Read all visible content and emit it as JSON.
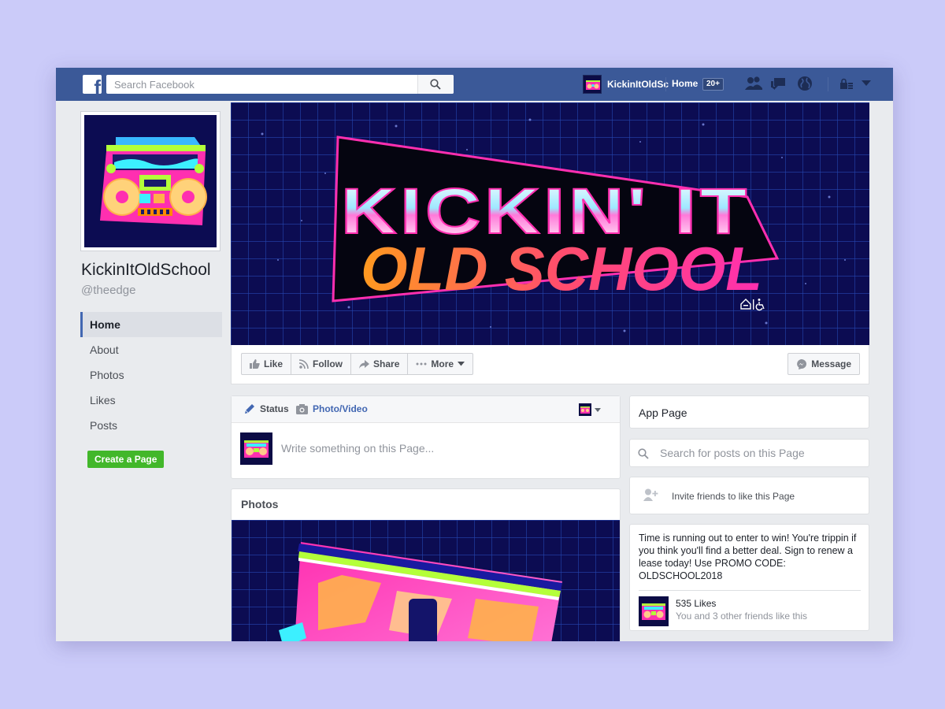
{
  "topbar": {
    "logo_letter": "f",
    "search_placeholder": "Search Facebook",
    "profile_name": "KickinItOldSc",
    "home_label": "Home",
    "home_badge": "20+"
  },
  "sidebar": {
    "page_name": "KickinItOldSchool",
    "handle": "@theedge",
    "items": [
      {
        "label": "Home"
      },
      {
        "label": "About"
      },
      {
        "label": "Photos"
      },
      {
        "label": "Likes"
      },
      {
        "label": "Posts"
      }
    ],
    "create_page_label": "Create a Page"
  },
  "cover": {
    "title_line1": "KICKIN' IT",
    "title_line2": "OLD SCHOOL"
  },
  "actions": {
    "like": "Like",
    "follow": "Follow",
    "share": "Share",
    "more": "More",
    "message": "Message"
  },
  "composer": {
    "status_tab": "Status",
    "photo_tab": "Photo/Video",
    "placeholder": "Write something on this Page..."
  },
  "photos": {
    "title": "Photos"
  },
  "right": {
    "app_page": "App Page",
    "search_placeholder": "Search for posts on this Page",
    "invite": "Invite friends to like this Page",
    "promo": "Time is running out to enter to win! You're trippin if you think you'll find a better deal. Sign to renew a lease today! Use PROMO CODE: OLDSCHOOL2018",
    "likes_count": "535 Likes",
    "likes_friends": "You and 3 other friends like this"
  },
  "colors": {
    "fb_blue": "#3b5998",
    "page_bg": "#e9ebee",
    "green_button": "#42b72a",
    "backdrop": "#cbcbf9",
    "cover_bg": "#0c0c52"
  }
}
